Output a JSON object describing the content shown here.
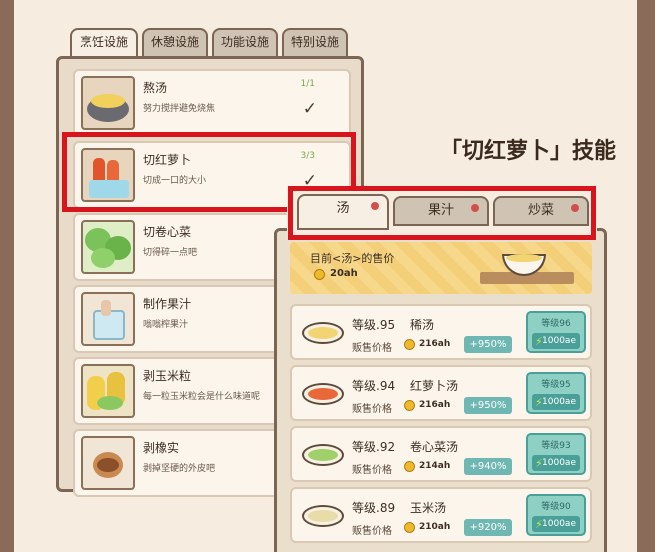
{
  "left_tabs": [
    "烹饪设施",
    "休憩设施",
    "功能设施",
    "特别设施"
  ],
  "recipes": [
    {
      "name": "熬汤",
      "desc": "努力搅拌避免烧焦",
      "count": "1/1",
      "check": "✓"
    },
    {
      "name": "切红萝卜",
      "desc": "切成一口的大小",
      "count": "3/3",
      "check": "✓"
    },
    {
      "name": "切卷心菜",
      "desc": "切得碎一点吧",
      "count": "",
      "check": ""
    },
    {
      "name": "制作果汁",
      "desc": "嗡嗡榨果汁",
      "count": "",
      "check": ""
    },
    {
      "name": "剥玉米粒",
      "desc": "每一粒玉米粒会是什么味道呢",
      "count": "",
      "check": ""
    },
    {
      "name": "剥橡实",
      "desc": "剥掉坚硬的外皮吧",
      "count": "",
      "check": ""
    }
  ],
  "skill_title": "「切红萝卜」技能",
  "right_tabs": [
    "汤",
    "果汁",
    "炒菜"
  ],
  "price_banner": {
    "label": "目前<汤>的售价",
    "value": "20ah"
  },
  "sell_label": "贩售价格",
  "levels": [
    {
      "level": "等级.95",
      "name": "稀汤",
      "price": "216ah",
      "bonus": "+950%",
      "next_level": "等级96",
      "cost": "1000ae"
    },
    {
      "level": "等级.94",
      "name": "红萝卜汤",
      "price": "216ah",
      "bonus": "+950%",
      "next_level": "等级95",
      "cost": "1000ae"
    },
    {
      "level": "等级.92",
      "name": "卷心菜汤",
      "price": "214ah",
      "bonus": "+940%",
      "next_level": "等级93",
      "cost": "1000ae"
    },
    {
      "level": "等级.89",
      "name": "玉米汤",
      "price": "210ah",
      "bonus": "+920%",
      "next_level": "等级90",
      "cost": "1000ae"
    }
  ],
  "colors": {
    "highlight": "#d8141c",
    "teal": "#6fb7b2",
    "banner": "#f7d88a"
  }
}
